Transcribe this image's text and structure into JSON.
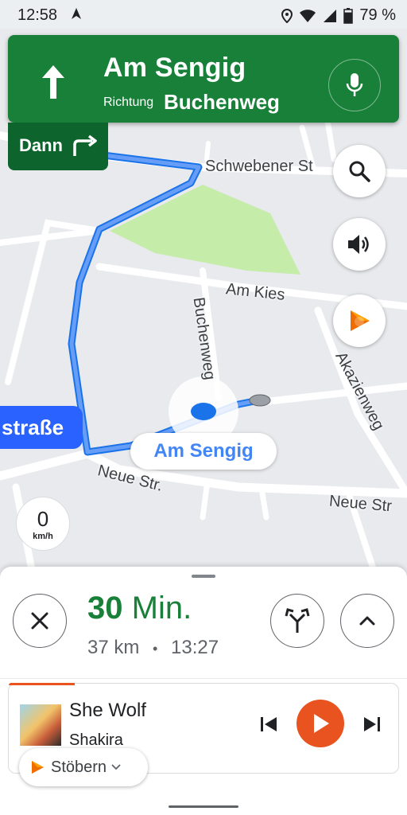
{
  "status_bar": {
    "time": "12:58",
    "battery_percent": "79 %",
    "battery_level": 0.79
  },
  "navigation": {
    "street": "Am Sengig",
    "toward_prefix": "Richtung",
    "toward_street": "Buchenweg",
    "then_label": "Dann"
  },
  "map": {
    "street_labels": {
      "schwebener": "Schwebener St",
      "am_kies": "Am Kies",
      "buchenweg": "Buchenweg",
      "akazienweg": "Akazienweg",
      "neue_str_1": "Neue Str.",
      "neue_str_2": "Neue Str"
    },
    "destination": "Am Sengig",
    "current_street": "straße",
    "speed_value": "0",
    "speed_unit": "km/h"
  },
  "trip": {
    "eta_value": "30",
    "eta_unit": "Min.",
    "distance": "37 km",
    "separator": "•",
    "arrival": "13:27"
  },
  "media": {
    "song": "She Wolf",
    "artist": "Shakira",
    "browse_label": "Stöbern",
    "progress": 0.17,
    "accent_color": "#e8531f"
  },
  "colors": {
    "banner_green": "#188038",
    "then_green": "#0d652d",
    "route_blue": "#4285f4",
    "eta_green": "#188038"
  },
  "icons": {
    "search": "search-icon",
    "sound": "volume-icon",
    "music_app": "google-play-music-icon",
    "close": "close-icon",
    "alternate_routes": "fork-route-icon",
    "expand": "chevron-up-icon"
  }
}
